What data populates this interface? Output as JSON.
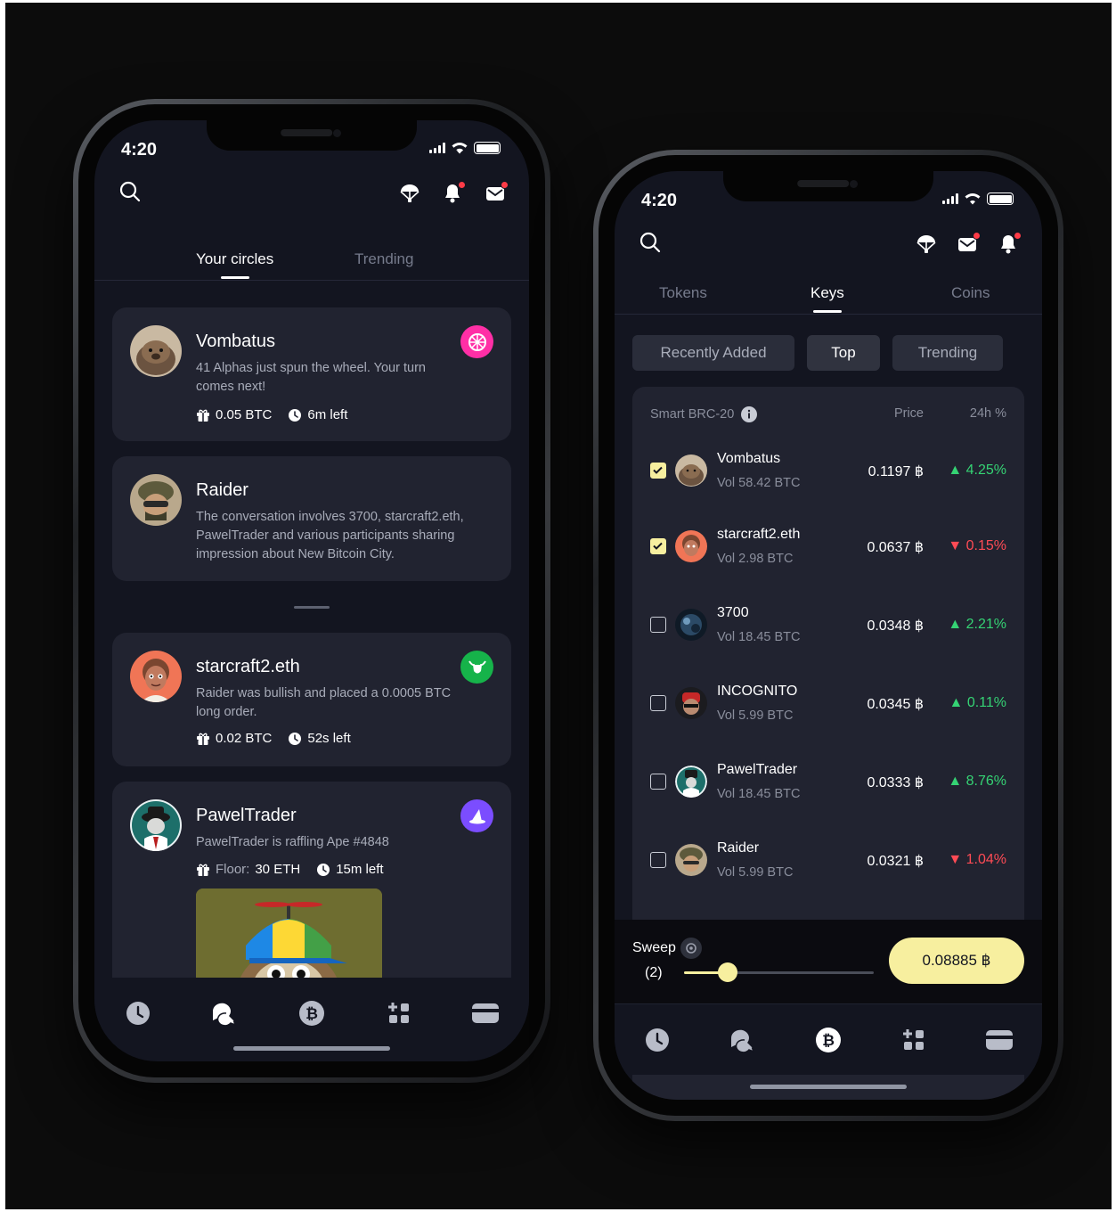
{
  "left_phone": {
    "status_time": "4:20",
    "tabs": [
      "Your circles",
      "Trending"
    ],
    "cards": [
      {
        "title": "Vombatus",
        "text": "41 Alphas just spun the wheel. Your turn comes next!",
        "amount": "0.05 BTC",
        "time": "6m left"
      },
      {
        "title": "Raider",
        "text": "The conversation involves 3700, starcraft2.eth, PawelTrader and various participants sharing impression about New Bitcoin City."
      },
      {
        "title": "starcraft2.eth",
        "text": "Raider was bullish and placed a 0.0005 BTC long order.",
        "amount": "0.02 BTC",
        "time": "52s left"
      },
      {
        "title": "PawelTrader",
        "text": "PawelTrader is raffling Ape #4848",
        "floor_label": "Floor:",
        "floor_value": "30 ETH",
        "time": "15m left"
      }
    ]
  },
  "right_phone": {
    "status_time": "4:20",
    "tabs": [
      "Tokens",
      "Keys",
      "Coins"
    ],
    "filters": [
      "Recently Added",
      "Top",
      "Trending"
    ],
    "table_headers": {
      "name": "Smart BRC-20",
      "price": "Price",
      "change": "24h %"
    },
    "rows": [
      {
        "name": "Vombatus",
        "vol": "Vol 58.42 BTC",
        "price": "0.1197 ฿",
        "change": "4.25%",
        "dir": "up",
        "checked": true
      },
      {
        "name": "starcraft2.eth",
        "vol": "Vol 2.98 BTC",
        "price": "0.0637 ฿",
        "change": "0.15%",
        "dir": "down",
        "checked": true
      },
      {
        "name": "3700",
        "vol": "Vol 18.45 BTC",
        "price": "0.0348 ฿",
        "change": "2.21%",
        "dir": "up",
        "checked": false
      },
      {
        "name": "INCOGNITO",
        "vol": "Vol 5.99 BTC",
        "price": "0.0345 ฿",
        "change": "0.11%",
        "dir": "up",
        "checked": false
      },
      {
        "name": "PawelTrader",
        "vol": "Vol 18.45 BTC",
        "price": "0.0333 ฿",
        "change": "8.76%",
        "dir": "up",
        "checked": false
      },
      {
        "name": "Raider",
        "vol": "Vol 5.99 BTC",
        "price": "0.0321 ฿",
        "change": "1.04%",
        "dir": "down",
        "checked": false
      }
    ],
    "sweep": {
      "label": "Sweep",
      "count": "(2)",
      "level": 0.23,
      "button": "0.08885 ฿"
    }
  },
  "colors": {
    "accent_yellow": "#f7ef9f",
    "up": "#35d374",
    "down": "#ff4b55",
    "screen_bg": "#131520",
    "card_bg": "#212330"
  },
  "icons": [
    "search-icon",
    "parachute-icon",
    "bell-icon",
    "mail-icon",
    "gift-icon",
    "clock-icon",
    "history-icon",
    "chat-icon",
    "bitcoin-icon",
    "apps-icon",
    "wallet-icon",
    "info-icon",
    "settings-icon"
  ]
}
